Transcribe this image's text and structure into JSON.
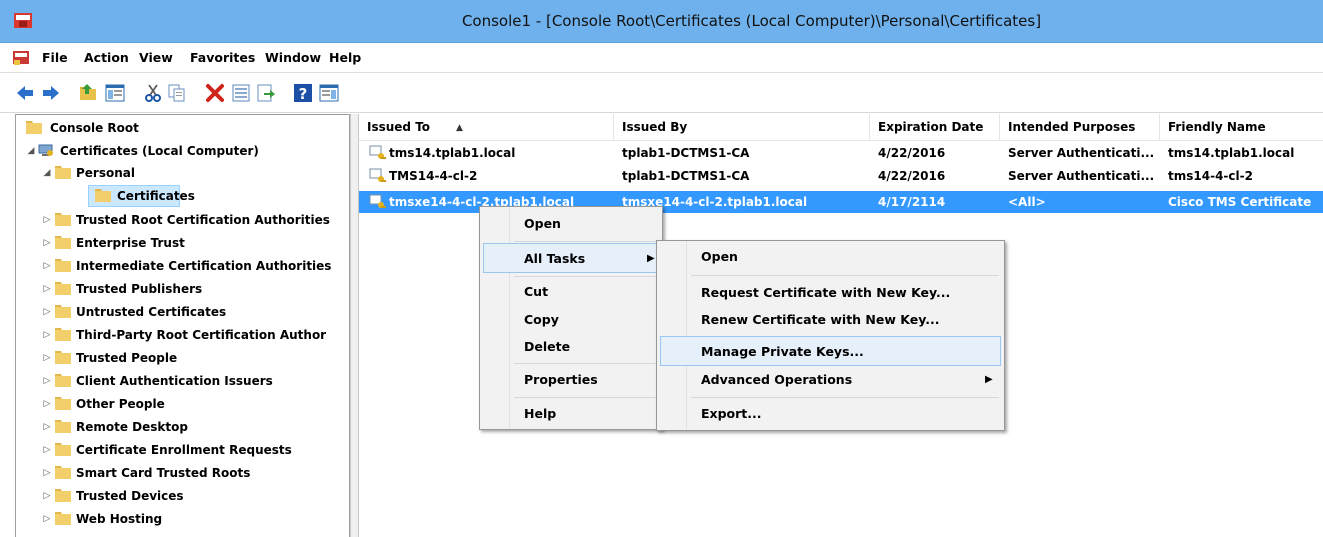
{
  "window": {
    "title": "Console1 - [Console Root\\Certificates (Local Computer)\\Personal\\Certificates]"
  },
  "menubar": [
    "File",
    "Action",
    "View",
    "Favorites",
    "Window",
    "Help"
  ],
  "toolbar": {
    "buttons": [
      "back-icon",
      "forward-icon",
      "up-folder-icon",
      "show-hide-tree-icon",
      "cut-icon",
      "copy-icon",
      "delete-icon",
      "properties-icon",
      "export-list-icon",
      "help-icon",
      "show-hide-action-pane-icon"
    ]
  },
  "tree": {
    "root": "Console Root",
    "certificates": "Certificates (Local Computer)",
    "personal": "Personal",
    "personal_certificates": "Certificates",
    "stores": [
      "Trusted Root Certification Authorities",
      "Enterprise Trust",
      "Intermediate Certification Authorities",
      "Trusted Publishers",
      "Untrusted Certificates",
      "Third-Party Root Certification Author",
      "Trusted People",
      "Client Authentication Issuers",
      "Other People",
      "Remote Desktop",
      "Certificate Enrollment Requests",
      "Smart Card Trusted Roots",
      "Trusted Devices",
      "Web Hosting"
    ]
  },
  "list": {
    "columns": [
      "Issued To",
      "Issued By",
      "Expiration Date",
      "Intended Purposes",
      "Friendly Name"
    ],
    "rows": [
      {
        "issued_to": "tms14.tplab1.local",
        "issued_by": "tplab1-DCTMS1-CA",
        "expiration": "4/22/2016",
        "purposes": "Server Authenticati...",
        "friendly": "tms14.tplab1.local"
      },
      {
        "issued_to": "TMS14-4-cl-2",
        "issued_by": "tplab1-DCTMS1-CA",
        "expiration": "4/22/2016",
        "purposes": "Server Authenticati...",
        "friendly": "tms14-4-cl-2"
      },
      {
        "issued_to": "tmsxe14-4-cl-2.tplab1.local",
        "issued_by": "tmsxe14-4-cl-2.tplab1.local",
        "expiration": "4/17/2114",
        "purposes": "<All>",
        "friendly": "Cisco TMS Certificate"
      }
    ]
  },
  "context_menu": {
    "open": "Open",
    "all_tasks": "All Tasks",
    "cut": "Cut",
    "copy": "Copy",
    "delete": "Delete",
    "properties": "Properties",
    "help": "Help"
  },
  "submenu": {
    "open": "Open",
    "request_new_key": "Request Certificate with New Key...",
    "renew_new_key": "Renew Certificate with New Key...",
    "manage_private_keys": "Manage Private Keys...",
    "advanced_operations": "Advanced Operations",
    "export": "Export..."
  },
  "colors": {
    "titlebar": "#6fb1ec",
    "selection": "#3399ff",
    "menu_highlight": "#e6f0fb"
  }
}
